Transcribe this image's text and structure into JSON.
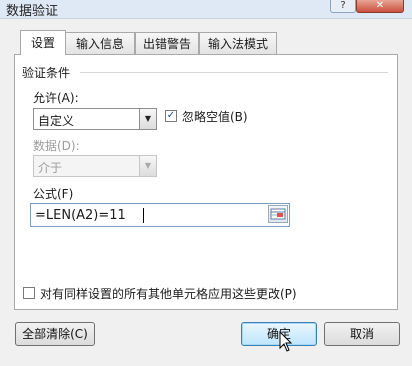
{
  "window": {
    "title": "数据验证",
    "help_label": "?",
    "close_label": "✕"
  },
  "tabs": [
    {
      "label": "设置",
      "active": true
    },
    {
      "label": "输入信息",
      "active": false
    },
    {
      "label": "出错警告",
      "active": false
    },
    {
      "label": "输入法模式",
      "active": false
    }
  ],
  "validation": {
    "section_title": "验证条件",
    "allow_label": "允许(A):",
    "allow_value": "自定义",
    "ignore_blank_label": "忽略空值(B)",
    "ignore_blank_checked": true,
    "data_label": "数据(D):",
    "data_value": "介于",
    "formula_label": "公式(F)",
    "formula_value": "=LEN(A2)=11"
  },
  "apply_all": {
    "label": "对有同样设置的所有其他单元格应用这些更改(P)",
    "checked": false
  },
  "buttons": {
    "clear_all": "全部清除(C)",
    "ok": "确定",
    "cancel": "取消"
  },
  "icons": {
    "dropdown": "chevron-down-icon",
    "range_picker": "range-select-icon",
    "cursor": "mouse-pointer-icon"
  }
}
